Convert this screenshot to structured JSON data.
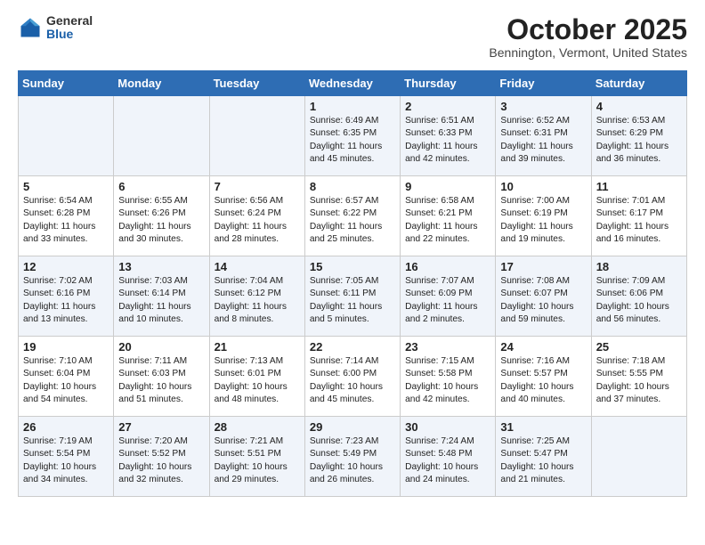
{
  "header": {
    "logo_general": "General",
    "logo_blue": "Blue",
    "title": "October 2025",
    "location": "Bennington, Vermont, United States"
  },
  "weekdays": [
    "Sunday",
    "Monday",
    "Tuesday",
    "Wednesday",
    "Thursday",
    "Friday",
    "Saturday"
  ],
  "weeks": [
    [
      {
        "day": "",
        "info": ""
      },
      {
        "day": "",
        "info": ""
      },
      {
        "day": "",
        "info": ""
      },
      {
        "day": "1",
        "info": "Sunrise: 6:49 AM\nSunset: 6:35 PM\nDaylight: 11 hours\nand 45 minutes."
      },
      {
        "day": "2",
        "info": "Sunrise: 6:51 AM\nSunset: 6:33 PM\nDaylight: 11 hours\nand 42 minutes."
      },
      {
        "day": "3",
        "info": "Sunrise: 6:52 AM\nSunset: 6:31 PM\nDaylight: 11 hours\nand 39 minutes."
      },
      {
        "day": "4",
        "info": "Sunrise: 6:53 AM\nSunset: 6:29 PM\nDaylight: 11 hours\nand 36 minutes."
      }
    ],
    [
      {
        "day": "5",
        "info": "Sunrise: 6:54 AM\nSunset: 6:28 PM\nDaylight: 11 hours\nand 33 minutes."
      },
      {
        "day": "6",
        "info": "Sunrise: 6:55 AM\nSunset: 6:26 PM\nDaylight: 11 hours\nand 30 minutes."
      },
      {
        "day": "7",
        "info": "Sunrise: 6:56 AM\nSunset: 6:24 PM\nDaylight: 11 hours\nand 28 minutes."
      },
      {
        "day": "8",
        "info": "Sunrise: 6:57 AM\nSunset: 6:22 PM\nDaylight: 11 hours\nand 25 minutes."
      },
      {
        "day": "9",
        "info": "Sunrise: 6:58 AM\nSunset: 6:21 PM\nDaylight: 11 hours\nand 22 minutes."
      },
      {
        "day": "10",
        "info": "Sunrise: 7:00 AM\nSunset: 6:19 PM\nDaylight: 11 hours\nand 19 minutes."
      },
      {
        "day": "11",
        "info": "Sunrise: 7:01 AM\nSunset: 6:17 PM\nDaylight: 11 hours\nand 16 minutes."
      }
    ],
    [
      {
        "day": "12",
        "info": "Sunrise: 7:02 AM\nSunset: 6:16 PM\nDaylight: 11 hours\nand 13 minutes."
      },
      {
        "day": "13",
        "info": "Sunrise: 7:03 AM\nSunset: 6:14 PM\nDaylight: 11 hours\nand 10 minutes."
      },
      {
        "day": "14",
        "info": "Sunrise: 7:04 AM\nSunset: 6:12 PM\nDaylight: 11 hours\nand 8 minutes."
      },
      {
        "day": "15",
        "info": "Sunrise: 7:05 AM\nSunset: 6:11 PM\nDaylight: 11 hours\nand 5 minutes."
      },
      {
        "day": "16",
        "info": "Sunrise: 7:07 AM\nSunset: 6:09 PM\nDaylight: 11 hours\nand 2 minutes."
      },
      {
        "day": "17",
        "info": "Sunrise: 7:08 AM\nSunset: 6:07 PM\nDaylight: 10 hours\nand 59 minutes."
      },
      {
        "day": "18",
        "info": "Sunrise: 7:09 AM\nSunset: 6:06 PM\nDaylight: 10 hours\nand 56 minutes."
      }
    ],
    [
      {
        "day": "19",
        "info": "Sunrise: 7:10 AM\nSunset: 6:04 PM\nDaylight: 10 hours\nand 54 minutes."
      },
      {
        "day": "20",
        "info": "Sunrise: 7:11 AM\nSunset: 6:03 PM\nDaylight: 10 hours\nand 51 minutes."
      },
      {
        "day": "21",
        "info": "Sunrise: 7:13 AM\nSunset: 6:01 PM\nDaylight: 10 hours\nand 48 minutes."
      },
      {
        "day": "22",
        "info": "Sunrise: 7:14 AM\nSunset: 6:00 PM\nDaylight: 10 hours\nand 45 minutes."
      },
      {
        "day": "23",
        "info": "Sunrise: 7:15 AM\nSunset: 5:58 PM\nDaylight: 10 hours\nand 42 minutes."
      },
      {
        "day": "24",
        "info": "Sunrise: 7:16 AM\nSunset: 5:57 PM\nDaylight: 10 hours\nand 40 minutes."
      },
      {
        "day": "25",
        "info": "Sunrise: 7:18 AM\nSunset: 5:55 PM\nDaylight: 10 hours\nand 37 minutes."
      }
    ],
    [
      {
        "day": "26",
        "info": "Sunrise: 7:19 AM\nSunset: 5:54 PM\nDaylight: 10 hours\nand 34 minutes."
      },
      {
        "day": "27",
        "info": "Sunrise: 7:20 AM\nSunset: 5:52 PM\nDaylight: 10 hours\nand 32 minutes."
      },
      {
        "day": "28",
        "info": "Sunrise: 7:21 AM\nSunset: 5:51 PM\nDaylight: 10 hours\nand 29 minutes."
      },
      {
        "day": "29",
        "info": "Sunrise: 7:23 AM\nSunset: 5:49 PM\nDaylight: 10 hours\nand 26 minutes."
      },
      {
        "day": "30",
        "info": "Sunrise: 7:24 AM\nSunset: 5:48 PM\nDaylight: 10 hours\nand 24 minutes."
      },
      {
        "day": "31",
        "info": "Sunrise: 7:25 AM\nSunset: 5:47 PM\nDaylight: 10 hours\nand 21 minutes."
      },
      {
        "day": "",
        "info": ""
      }
    ]
  ]
}
